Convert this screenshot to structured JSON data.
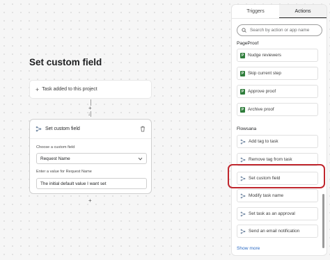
{
  "editor": {
    "title": "Set custom field",
    "trigger_card": {
      "label": "Task added to this project"
    },
    "action_card": {
      "title": "Set custom field",
      "field_label": "Choose a custom field",
      "field_value": "Request Name",
      "value_label": "Enter a value for Request Name",
      "value_input": "The initial default value I want set"
    }
  },
  "panel": {
    "tabs": [
      "Triggers",
      "Actions"
    ],
    "active_tab": "Actions",
    "search_placeholder": "Search by action or app name",
    "groups": [
      {
        "name": "PageProof",
        "icon": "pageproof-icon",
        "items": [
          "Nudge reviewers",
          "Skip current step",
          "Approve proof",
          "Archive proof"
        ]
      },
      {
        "name": "Flowsana",
        "icon": "flowsana-icon",
        "items": [
          "Add tag to task",
          "Remove tag from task",
          "Set custom field",
          "Modify task name",
          "Set task as an approval",
          "Send an email notification"
        ]
      }
    ],
    "highlighted_item": "Set custom field",
    "show_more": "Show more"
  },
  "colors": {
    "highlight": "#c0262d",
    "pageproof_green": "#2f7d3b",
    "link": "#2c6bc4"
  }
}
